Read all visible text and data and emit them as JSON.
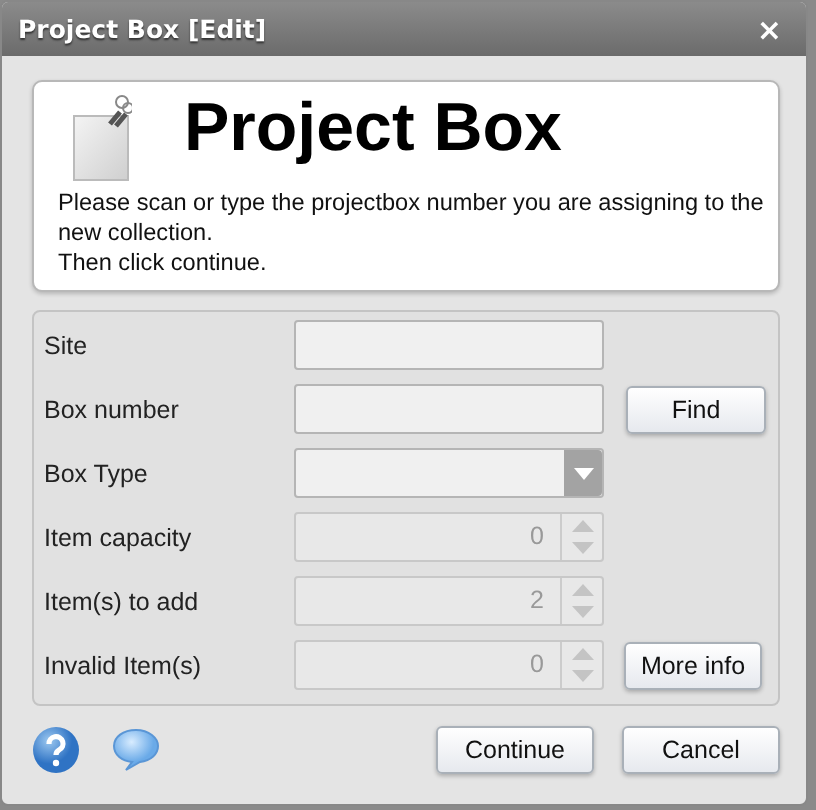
{
  "window": {
    "title": "Project Box [Edit]",
    "close": "×"
  },
  "header": {
    "title": "Project Box",
    "description": [
      "Please scan or type the projectbox number you are assigning to the new collection.",
      "Then click continue."
    ]
  },
  "fields": [
    {
      "label": "Site",
      "kind": "text",
      "disabled": false
    },
    {
      "label": "Box number",
      "kind": "text",
      "disabled": false,
      "button": "Find"
    },
    {
      "label": "Box Type",
      "kind": "select",
      "disabled": false
    },
    {
      "label": "Item capacity",
      "kind": "spinner",
      "value": "0",
      "disabled": true
    },
    {
      "label": "Item(s) to add",
      "kind": "spinner",
      "value": "2",
      "disabled": true
    },
    {
      "label": "Invalid Item(s)",
      "kind": "spinner",
      "value": "0",
      "disabled": true,
      "button": "More info"
    }
  ],
  "buttons": [
    "Continue",
    "Cancel"
  ]
}
